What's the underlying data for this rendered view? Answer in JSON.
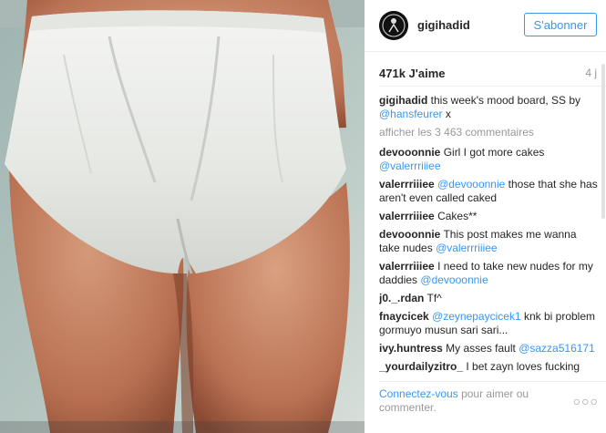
{
  "post": {
    "image_alt_icon": "photo",
    "username": "gigihadid",
    "follow_label": "S'abonner",
    "likes": "471k J'aime",
    "time": "4 j",
    "caption": {
      "user": "gigihadid",
      "text": "this week's mood board, SS by",
      "mention": "@hansfeurer",
      "tail": "x"
    },
    "more_comments": "afficher les 3 463 commentaires",
    "comments": [
      {
        "user": "devooonnie",
        "text": "Girl I got more cakes",
        "mention": "@valerrriiiee",
        "tail": ""
      },
      {
        "user": "valerrriiiee",
        "text": "",
        "mention": "@devooonnie",
        "tail": "those that she has aren't even called caked"
      },
      {
        "user": "valerrriiiee",
        "text": "Cakes**",
        "mention": "",
        "tail": ""
      },
      {
        "user": "devooonnie",
        "text": "This post makes me wanna take nudes",
        "mention": "@valerrriiiee",
        "tail": ""
      },
      {
        "user": "valerrriiiee",
        "text": "I need to take new nudes for my daddies",
        "mention": "@devooonnie",
        "tail": ""
      },
      {
        "user": "j0._.rdan",
        "text": "Tf^",
        "mention": "",
        "tail": ""
      },
      {
        "user": "fnaycicek",
        "text": "",
        "mention": "@zeynepaycicek1",
        "tail": "knk bi problem gormuyo musun sari sari..."
      },
      {
        "user": "ivy.huntress",
        "text": "My asses fault",
        "mention": "@sazza516171",
        "tail": ""
      },
      {
        "user": "_yourdailyzitro_",
        "text": "I bet zayn loves fucking",
        "mention": "",
        "tail": ""
      }
    ],
    "login_link": "Connectez-vous",
    "login_text": "pour aimer ou commenter.",
    "more_options": "○○○"
  }
}
